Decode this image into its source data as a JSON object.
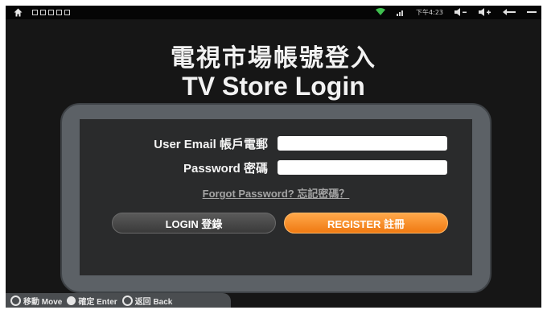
{
  "status_bar": {
    "time": "下午4:23"
  },
  "title": {
    "chinese": "電視市場帳號登入",
    "english": "TV Store Login"
  },
  "form": {
    "email_label": "User Email 帳戶電郵",
    "email_value": "",
    "password_label": "Password 密碼",
    "password_value": "",
    "forgot_link": "Forgot Password? 忘記密碼？",
    "login_button": "LOGIN 登錄",
    "register_button": "REGISTER 註冊"
  },
  "hints": {
    "move": "移動 Move",
    "enter": "確定 Enter",
    "back": "返回 Back"
  },
  "colors": {
    "register_accent": "#f58a20",
    "panel": "#5c6166",
    "background": "#161616"
  }
}
